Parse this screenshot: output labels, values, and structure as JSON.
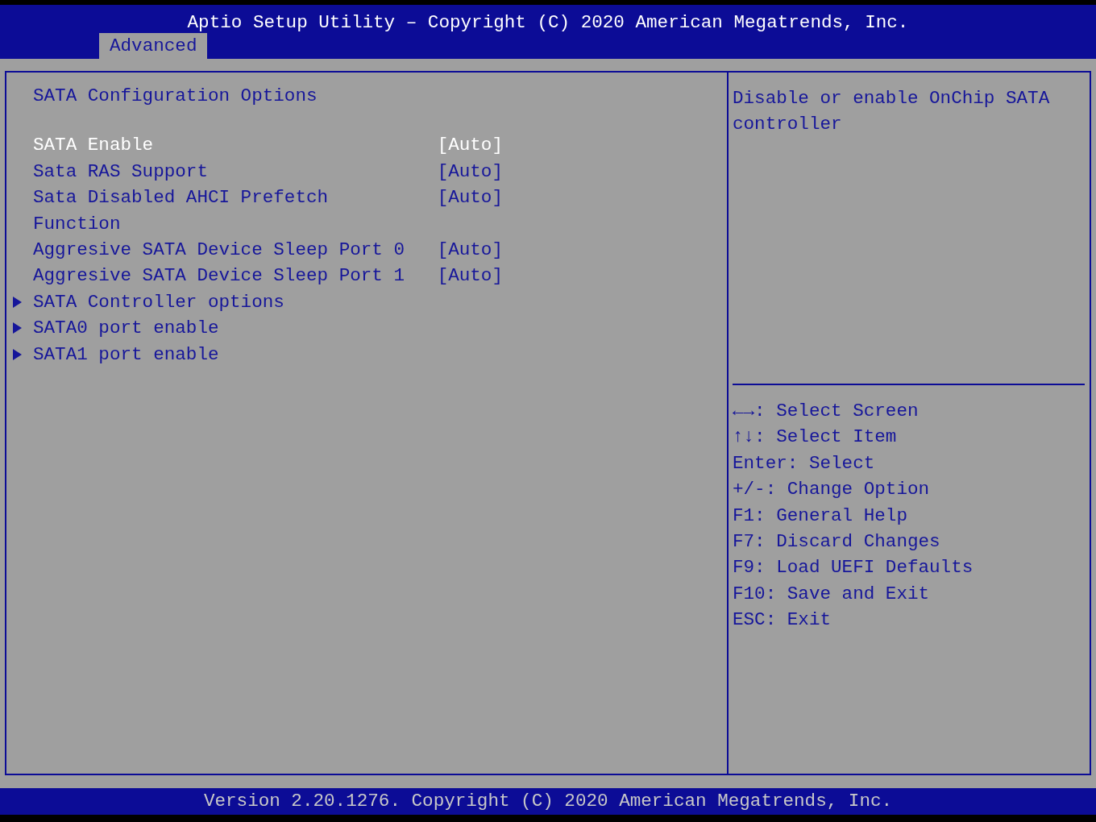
{
  "header": {
    "title": "Aptio Setup Utility – Copyright (C) 2020 American Megatrends, Inc.",
    "tabs": [
      {
        "label": "Advanced",
        "selected": true
      }
    ]
  },
  "menu": {
    "heading": "SATA Configuration Options",
    "items": [
      {
        "kind": "setting",
        "label": "SATA Enable",
        "value": "[Auto]",
        "selected": true
      },
      {
        "kind": "setting",
        "label": "Sata RAS Support",
        "value": "[Auto]",
        "selected": false
      },
      {
        "kind": "setting",
        "label": "Sata Disabled AHCI Prefetch Function",
        "value": "[Auto]",
        "selected": false
      },
      {
        "kind": "setting",
        "label": "Aggresive SATA Device Sleep Port 0",
        "value": "[Auto]",
        "selected": false
      },
      {
        "kind": "setting",
        "label": "Aggresive SATA Device Sleep Port 1",
        "value": "[Auto]",
        "selected": false
      },
      {
        "kind": "submenu",
        "label": "SATA Controller options",
        "selected": false
      },
      {
        "kind": "submenu",
        "label": "SATA0 port enable",
        "selected": false
      },
      {
        "kind": "submenu",
        "label": "SATA1 port enable",
        "selected": false
      }
    ]
  },
  "help": {
    "text": "Disable or enable OnChip SATA controller",
    "keys": [
      "←→: Select Screen",
      "↑↓: Select Item",
      "Enter: Select",
      "+/-: Change Option",
      "F1: General Help",
      "F7: Discard Changes",
      "F9: Load UEFI Defaults",
      "F10: Save and Exit",
      "ESC: Exit"
    ]
  },
  "footer": {
    "text": "Version 2.20.1276. Copyright (C) 2020 American Megatrends, Inc."
  }
}
